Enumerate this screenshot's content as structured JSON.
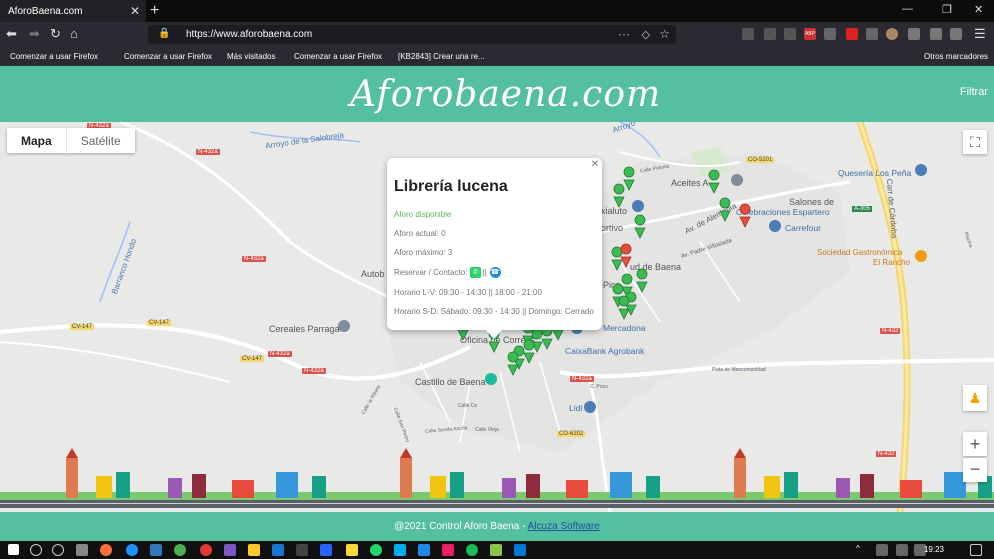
{
  "browser": {
    "tab_title": "AforoBaena.com",
    "url": "https://www.aforobaena.com",
    "bookmarks": [
      "Comenzar a usar Firefox",
      "Comenzar a usar Firefox",
      "Más visitados",
      "Comenzar a usar Firefox",
      "[KB2843] Crear una re...",
      "Otros marcadores"
    ],
    "adblock_badge": "ABP"
  },
  "header": {
    "logo": "Aforobaena.com",
    "filter_label": "Filtrar"
  },
  "map": {
    "type_map": "Mapa",
    "type_satellite": "Satélite",
    "labels": {
      "arroyo_salobreja": "Arroyo de la Salobreja",
      "arroyo": "Arroyo",
      "barranco_hondo": "Barranco Hondo",
      "autobus": "Autob",
      "cereales_parraga": "Cereales Parraga",
      "oficina_correos": "Oficina de Correos",
      "castillo": "Castillo de Baena",
      "caixabank": "CaixaBank Agrobank",
      "mercadona": "Mercadona",
      "lidl": "Lidl",
      "aceites": "Aceites A",
      "celebraciones": "Celebraciones Espartero",
      "salones": "Salones de",
      "carrefour": "Carrefour",
      "queseria": "Quesería Los Peña",
      "sociedad": "Sociedad Gastronómica",
      "el_rancho": "El Rancho",
      "carr_cordoba": "Carr de Córdoba",
      "av_alemania": "Av. de Alemania",
      "av_vilaubaria": "Av. Padre Villoslada",
      "ud_baena": "ud de Baena",
      "deportivo": "ortivo",
      "axialuto": "xialuto",
      "pico": "Pico",
      "n432a_1": "N-432a",
      "n432a_2": "N-432a",
      "n432a_3": "N-432a",
      "n432a_4": "N-432a",
      "n432a_5": "N-432a",
      "n432_1": "N-432",
      "n432_2": "N-432",
      "cv147_1": "CV-147",
      "cv147_2": "CV-147",
      "cv147_3": "CV-147",
      "co5201": "CO-5201",
      "co6202": "CO-6202",
      "a305": "A-305",
      "calle_mancomunidad": "Pista de Mancomunidad",
      "calle_la_ribera": "Calle la Ribera",
      "calle_san_pedro": "Calle San Pedro",
      "calle_senda": "Calle Senda Ancha",
      "calle_vieja": "Calle Vieja",
      "calle_ce": "Calle Ce",
      "c_pozo": "C. Pozo",
      "calle_poeta": "Calle Polonia",
      "piscina": "Piscina"
    }
  },
  "info_window": {
    "title": "Librería lucena",
    "status": "Aforo disponible",
    "current": "Aforo actual: 0",
    "max": "Aforo máximo: 3",
    "contact_label": "Reservar / Contacto:",
    "separator": "||",
    "hours_weekday": "Horario L-V: 09:30 - 14:30 || 18:00 - 21:00",
    "hours_weekend": "Horario S-D: Sábado: 09:30 - 14:30 || Domingo: Cerrado"
  },
  "footer": {
    "text": "@2021 Control Aforo Baena - ",
    "link": "Alcuza Software"
  },
  "taskbar": {
    "clock": "19:23"
  },
  "colors": {
    "brand": "#55c0a0",
    "marker_green": "#3cba54",
    "marker_red": "#e74c3c"
  }
}
